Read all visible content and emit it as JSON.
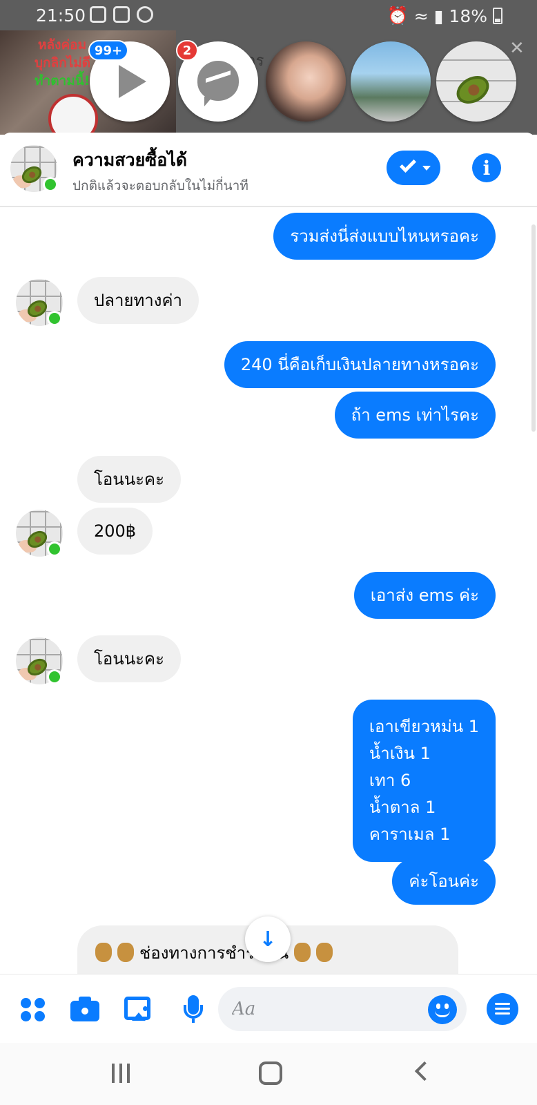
{
  "status_bar": {
    "time": "21:50",
    "battery": "18%"
  },
  "chat_heads": {
    "video_badge": "99+",
    "messenger_badge": "2",
    "background_video_text": [
      "หลังค่อม",
      "บุกลิกไม่ดี",
      "ทำตามนี้!"
    ],
    "background_text": "อาร"
  },
  "header": {
    "name": "ความสวยซื้อได้",
    "status": "ปกติแล้วจะตอบกลับในไม่กี่นาที"
  },
  "messages": [
    {
      "from": "me",
      "text": "รวมส่งนี่ส่งแบบไหนหรอคะ"
    },
    {
      "from": "them",
      "text": "ปลายทางค่า"
    },
    {
      "from": "me",
      "text": "240 นี่คือเก็บเงินปลายทางหรอคะ"
    },
    {
      "from": "me",
      "text": "ถ้า ems เท่าไรคะ"
    },
    {
      "from": "them",
      "text": "โอนนะคะ"
    },
    {
      "from": "them",
      "text": "200฿"
    },
    {
      "from": "me",
      "text": "เอาส่ง ems ค่ะ"
    },
    {
      "from": "them",
      "text": "โอนนะคะ"
    },
    {
      "from": "me",
      "lines": [
        "เอาเขียวหม่น 1",
        "น้ำเงิน 1",
        "เทา 6",
        "น้ำตาล 1",
        "คาราเมล 1"
      ]
    },
    {
      "from": "me",
      "text": "ค่ะโอนค่ะ"
    },
    {
      "from": "them",
      "text": "ช่องทางการชำระเงิน"
    }
  ],
  "composer": {
    "placeholder": "Aa"
  },
  "colors": {
    "accent": "#0a7cff",
    "incoming_bubble": "#f0f0f0",
    "online": "#31c32f",
    "badge_red": "#e53935"
  },
  "icons": {
    "header": [
      "check-icon",
      "info-icon"
    ],
    "composer": [
      "apps-icon",
      "camera-icon",
      "image-icon",
      "mic-icon",
      "emoji-icon",
      "menu-icon"
    ],
    "nav": [
      "recent-apps-icon",
      "home-icon",
      "back-icon"
    ]
  }
}
